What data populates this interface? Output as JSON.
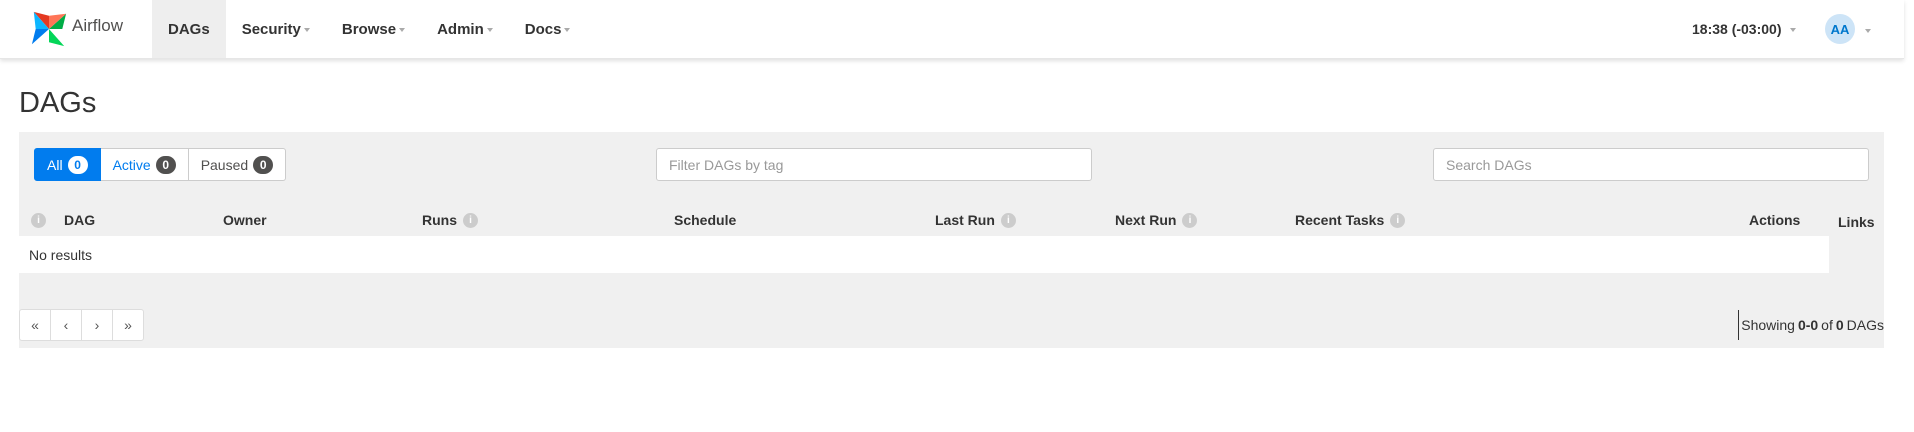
{
  "brand": {
    "name": "Airflow"
  },
  "nav": [
    {
      "label": "DAGs",
      "active": true
    },
    {
      "label": "Security"
    },
    {
      "label": "Browse"
    },
    {
      "label": "Admin"
    },
    {
      "label": "Docs"
    }
  ],
  "time": "18:38 (-03:00)",
  "user": {
    "initials": "AA"
  },
  "page": {
    "title": "DAGs"
  },
  "filters": {
    "all": {
      "label": "All",
      "count": "0"
    },
    "active": {
      "label": "Active",
      "count": "0"
    },
    "paused": {
      "label": "Paused",
      "count": "0"
    }
  },
  "tag_filter": {
    "placeholder": "Filter DAGs by tag"
  },
  "search": {
    "placeholder": "Search DAGs"
  },
  "table": {
    "columns": {
      "dag": "DAG",
      "owner": "Owner",
      "runs": "Runs",
      "schedule": "Schedule",
      "last_run": "Last Run",
      "next_run": "Next Run",
      "recent_tasks": "Recent Tasks",
      "actions": "Actions",
      "links": "Links"
    },
    "empty_text": "No results"
  },
  "pagination": {
    "first": "«",
    "prev": "‹",
    "next": "›",
    "last": "»"
  },
  "showing": {
    "prefix": "Showing",
    "range": "0-0",
    "of": "of",
    "total": "0",
    "suffix": "DAGs"
  },
  "colors": {
    "accent": "#017cee",
    "badge": "#51504f",
    "panel": "#f0f0f0"
  },
  "icons": {
    "info": "info-icon",
    "logo": "airflow-pinwheel-logo"
  }
}
